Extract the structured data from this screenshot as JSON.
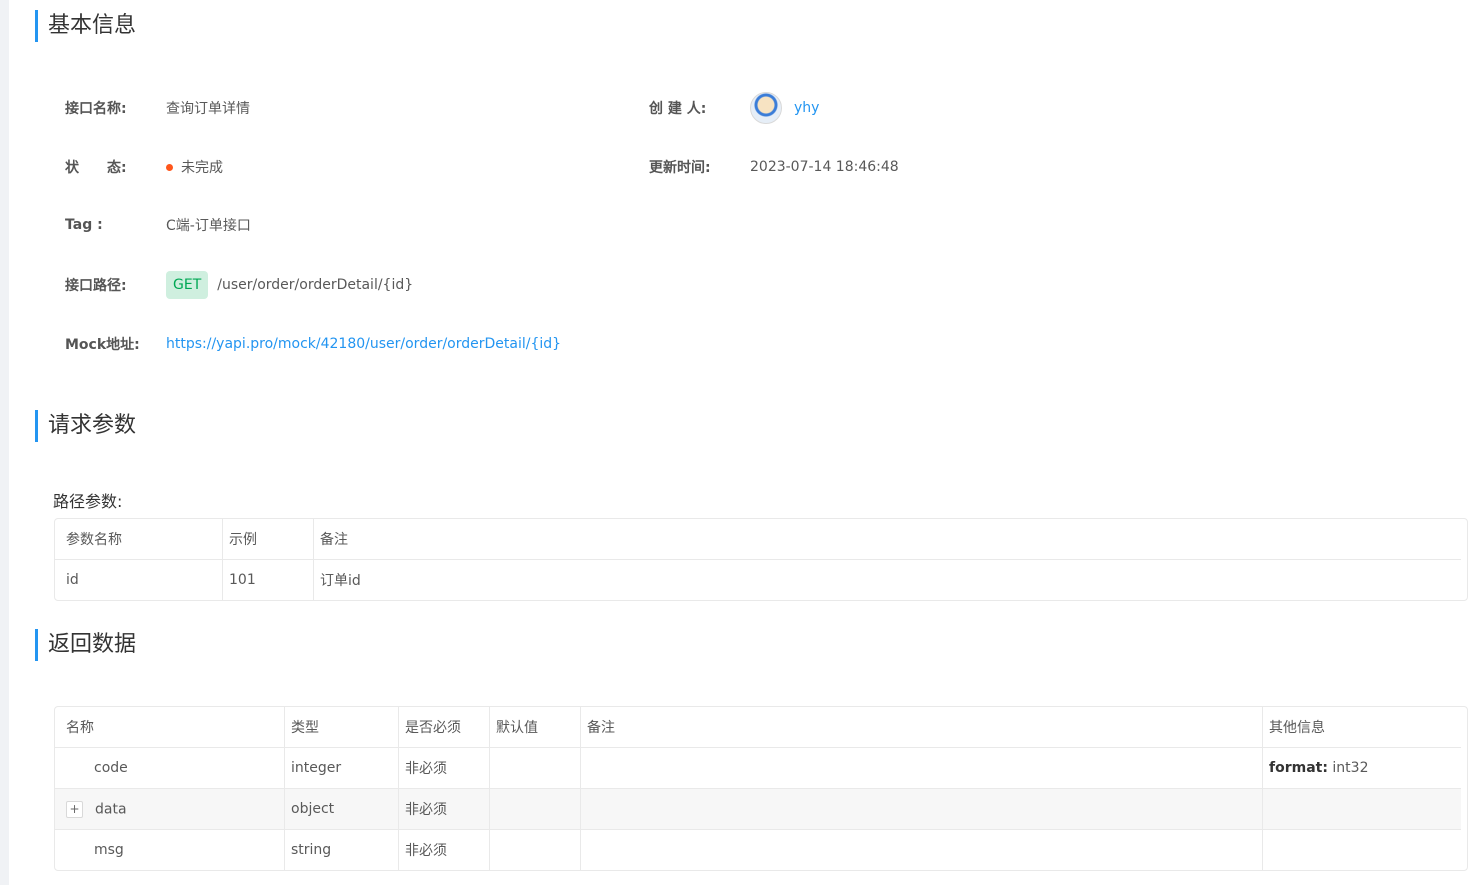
{
  "sections": {
    "basic_info": "基本信息",
    "request_params": "请求参数",
    "response_data": "返回数据"
  },
  "basic": {
    "name_label": "接口名称:",
    "name_value": "查询订单详情",
    "creator_label": "创 建 人:",
    "creator_value": "yhy",
    "status_label": "状　　态:",
    "status_value": "未完成",
    "updated_label": "更新时间:",
    "updated_value": "2023-07-14 18:46:48",
    "tag_label": "Tag :",
    "tag_value": "C端-订单接口",
    "path_label": "接口路径:",
    "method": "GET",
    "path_value": "/user/order/orderDetail/{id}",
    "mock_label": "Mock地址:",
    "mock_value": "https://yapi.pro/mock/42180/user/order/orderDetail/{id}"
  },
  "path_params": {
    "label": "路径参数:",
    "headers": [
      "参数名称",
      "示例",
      "备注"
    ],
    "rows": [
      {
        "name": "id",
        "example": "101",
        "remark": "订单id"
      }
    ]
  },
  "response": {
    "headers": [
      "名称",
      "类型",
      "是否必须",
      "默认值",
      "备注",
      "其他信息"
    ],
    "rows": [
      {
        "name": "code",
        "type": "integer",
        "required": "非必须",
        "default": "",
        "remark": "",
        "other_key": "format:",
        "other_val": "int32"
      },
      {
        "name": "data",
        "type": "object",
        "required": "非必须",
        "default": "",
        "remark": "",
        "other_key": "",
        "other_val": ""
      },
      {
        "name": "msg",
        "type": "string",
        "required": "非必须",
        "default": "",
        "remark": "",
        "other_key": "",
        "other_val": ""
      }
    ]
  },
  "colors": {
    "accent": "#2395f1",
    "status_dot": "#ff561b",
    "method_bg": "#cfefdf",
    "method_text": "#00a854"
  }
}
